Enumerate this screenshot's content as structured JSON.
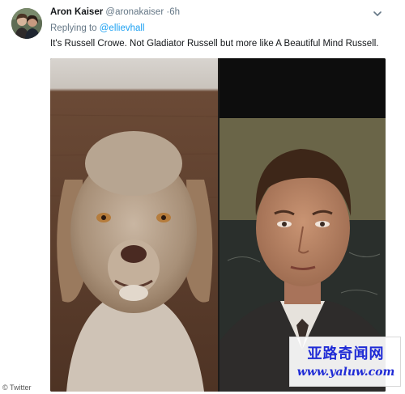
{
  "tweet": {
    "display_name": "Aron Kaiser",
    "handle": "@aronakaiser",
    "separator": "·",
    "time": "6h",
    "reply_prefix": "Replying to",
    "reply_user": "@ellievhall",
    "text": "It's Russell Crowe.  Not Gladiator Russell but more like A Beautiful Mind Russell.",
    "menu_icon": "chevron-down-icon"
  },
  "media": {
    "left_image": "dog-face-photo",
    "right_image": "man-face-photo"
  },
  "overlay": {
    "source_label": "© Twitter",
    "watermark_line1": "亚路奇闻网",
    "watermark_line2": "www.yaluw.com"
  },
  "colors": {
    "link": "#1da1f2",
    "muted": "#657786",
    "watermark": "#1f2bd6"
  }
}
